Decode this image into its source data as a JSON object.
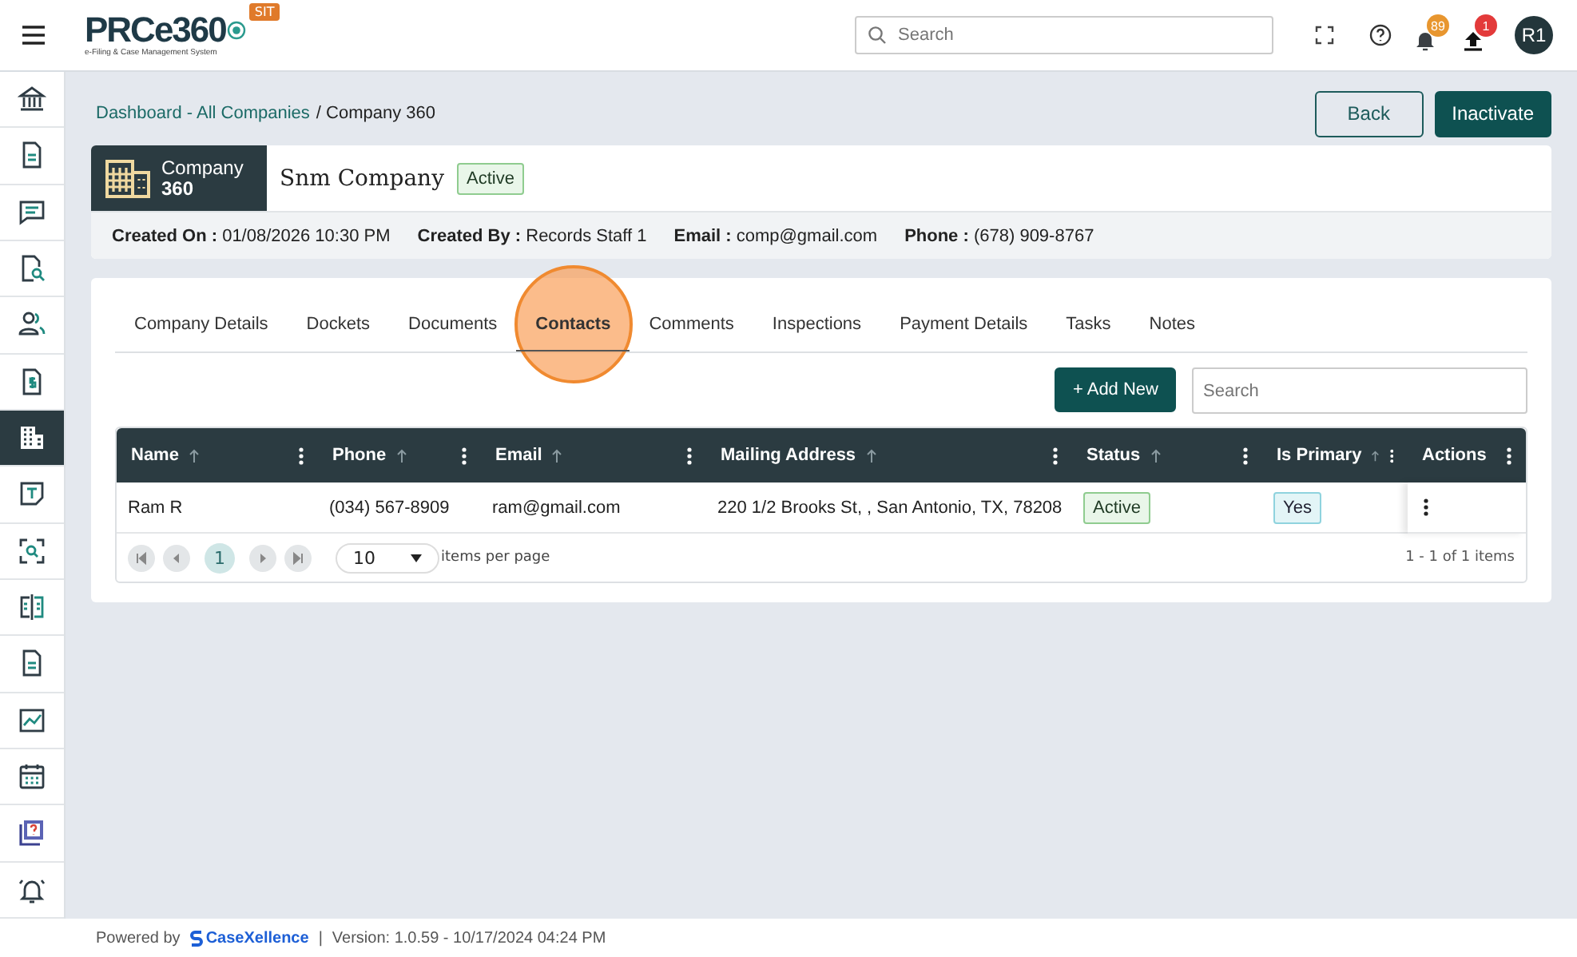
{
  "header": {
    "logo": "PRCe360",
    "tagline": "e-Filing & Case Management System",
    "env_badge": "SIT",
    "search": {
      "placeholder": "Search"
    },
    "notifications": "89",
    "uploads": "1",
    "avatar": "R1"
  },
  "sidebar": {
    "items": [
      {
        "kind": "bank",
        "selected": false
      },
      {
        "kind": "document",
        "selected": false
      },
      {
        "kind": "chat",
        "selected": false
      },
      {
        "kind": "doc-search",
        "selected": false
      },
      {
        "kind": "users",
        "selected": false
      },
      {
        "kind": "invoice",
        "selected": false
      },
      {
        "kind": "building",
        "selected": true
      },
      {
        "kind": "note",
        "selected": false
      },
      {
        "kind": "scan",
        "selected": false
      },
      {
        "kind": "compare",
        "selected": false
      },
      {
        "kind": "document",
        "selected": false
      },
      {
        "kind": "chart",
        "selected": false
      },
      {
        "kind": "calendar",
        "selected": false
      },
      {
        "kind": "help",
        "selected": false
      },
      {
        "kind": "bell",
        "selected": false
      }
    ]
  },
  "breadcrumb": {
    "link": "Dashboard - All Companies",
    "current": "/ Company 360"
  },
  "actions": [
    {
      "label": "Back",
      "kind": "outline"
    },
    {
      "label": "Inactivate",
      "kind": "primary"
    }
  ],
  "entity": {
    "type": "Company",
    "number": "360",
    "name": "Snm Company",
    "status": "Active"
  },
  "info": [
    {
      "label": "Created On :",
      "value": "01/08/2026 10:30 PM"
    },
    {
      "label": "Created By :",
      "value": "Records Staff 1"
    },
    {
      "label": "Email :",
      "value": "comp@gmail.com"
    },
    {
      "label": "Phone :",
      "value": "(678) 909-8767"
    }
  ],
  "tabs": [
    {
      "label": "Company Details",
      "selected": false
    },
    {
      "label": "Dockets",
      "selected": false
    },
    {
      "label": "Documents",
      "selected": false
    },
    {
      "label": "Contacts",
      "selected": true
    },
    {
      "label": "Comments",
      "selected": false
    },
    {
      "label": "Inspections",
      "selected": false
    },
    {
      "label": "Payment Details",
      "selected": false
    },
    {
      "label": "Tasks",
      "selected": false
    },
    {
      "label": "Notes",
      "selected": false
    }
  ],
  "add_button": "+ Add New",
  "table_search": {
    "placeholder": "Search"
  },
  "table": {
    "columns": [
      {
        "label": "Name",
        "sortable": true
      },
      {
        "label": "Phone",
        "sortable": true
      },
      {
        "label": "Email",
        "sortable": true
      },
      {
        "label": "Mailing Address",
        "sortable": true
      },
      {
        "label": "Status",
        "sortable": true
      },
      {
        "label": "Is Primary",
        "sortable": true
      },
      {
        "label": "Actions",
        "sortable": false
      }
    ],
    "rows": [
      {
        "name": "Ram R",
        "phone": "(034) 567-8909",
        "email": "ram@gmail.com",
        "address": "220 1/2 Brooks St, , San Antonio, TX, 78208",
        "status": "Active",
        "primary": "Yes"
      }
    ]
  },
  "pager": {
    "page": "1",
    "page_size": "10",
    "per_page_label": "items per page",
    "summary": "1 - 1 of 1 items"
  },
  "footer": {
    "powered": "Powered by",
    "brand": "CaseXellence",
    "separator": "|",
    "version": "Version: 1.0.59 - 10/17/2024 04:24 PM"
  }
}
